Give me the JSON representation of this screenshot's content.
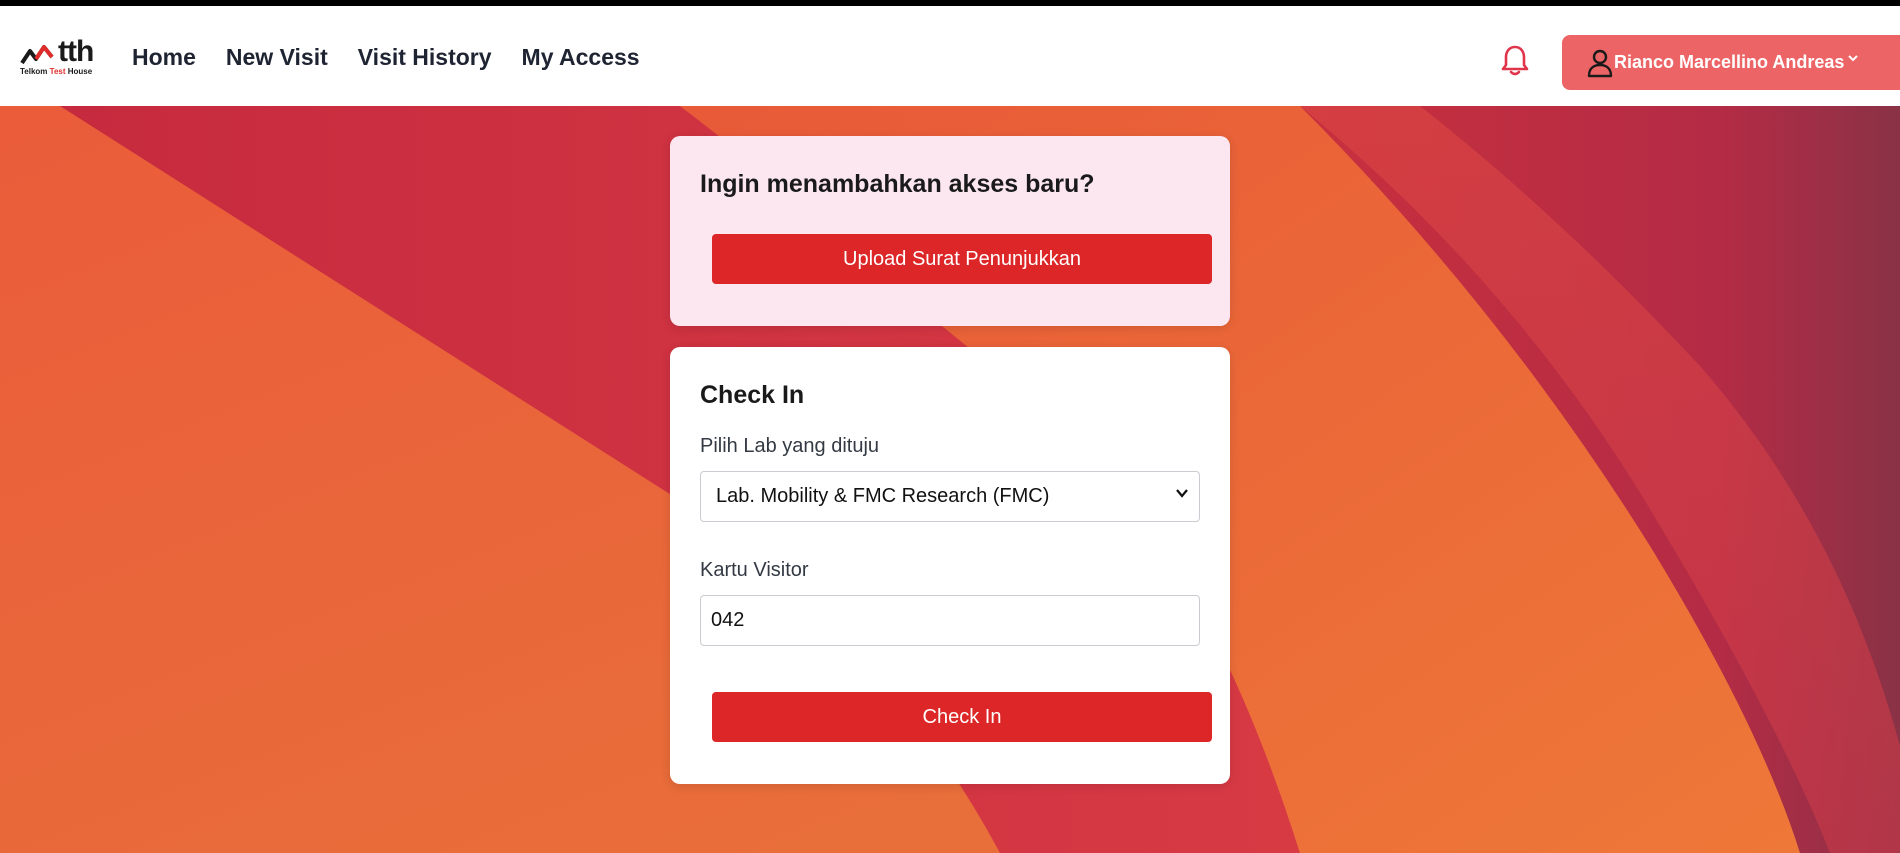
{
  "app": {
    "logo_text": "tth",
    "logo_sub_left": "Telkom",
    "logo_sub_red": "Test",
    "logo_sub_right": "House"
  },
  "nav": {
    "items": [
      {
        "label": "Home"
      },
      {
        "label": "New Visit"
      },
      {
        "label": "Visit History"
      },
      {
        "label": "My Access"
      }
    ]
  },
  "user": {
    "name": "Rianco Marcellino Andreas"
  },
  "access_card": {
    "title": "Ingin menambahkan akses baru?",
    "button_label": "Upload Surat Penunjukkan"
  },
  "checkin_card": {
    "title": "Check In",
    "lab_label": "Pilih Lab yang dituju",
    "lab_selected": "Lab. Mobility & FMC Research (FMC)",
    "visitor_label": "Kartu Visitor",
    "visitor_value": "042",
    "button_label": "Check In"
  },
  "colors": {
    "brand_red": "#dc2627",
    "user_button": "#ec6466",
    "bell": "#e0344a",
    "access_card_bg": "#fce7f1"
  },
  "icons": {
    "bell": "bell-icon",
    "user": "user-icon",
    "caret": "chevron-down-icon"
  }
}
